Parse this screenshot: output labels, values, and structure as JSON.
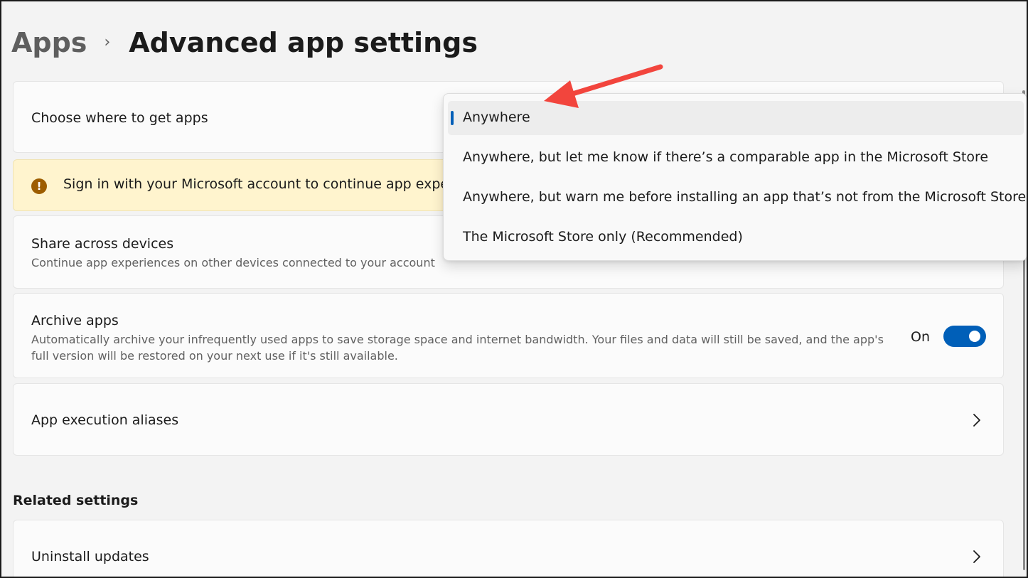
{
  "breadcrumb": {
    "parent": "Apps",
    "current": "Advanced app settings"
  },
  "rows": {
    "choose_apps": {
      "title": "Choose where to get apps"
    },
    "warning": {
      "text": "Sign in with your Microsoft account to continue app exper"
    },
    "share": {
      "title": "Share across devices",
      "description": "Continue app experiences on other devices connected to your account"
    },
    "archive": {
      "title": "Archive apps",
      "description_line1": "Automatically archive your infrequently used apps to save storage space and internet bandwidth. Your files and data will still be saved, and the app's",
      "description_line2": "full version will be restored on your next use if it's still available.",
      "toggle_label": "On",
      "toggle_on": true
    },
    "aliases": {
      "title": "App execution aliases"
    }
  },
  "related": {
    "header": "Related settings",
    "uninstall": {
      "title": "Uninstall updates"
    }
  },
  "dropdown": {
    "options": [
      "Anywhere",
      "Anywhere, but let me know if there’s a comparable app in the Microsoft Store",
      "Anywhere, but warn me before installing an app that’s not from the Microsoft Store",
      "The Microsoft Store only (Recommended)"
    ],
    "selected_index": 0
  },
  "colors": {
    "accent": "#005fb8",
    "warning_bg": "#fff4ce",
    "warning_icon": "#9d5d00",
    "annotation_arrow": "#f2453d"
  },
  "icons": {
    "warning": "exclamation-circle-icon",
    "chevron": "chevron-right-icon",
    "arrow": "red-annotation-arrow"
  }
}
